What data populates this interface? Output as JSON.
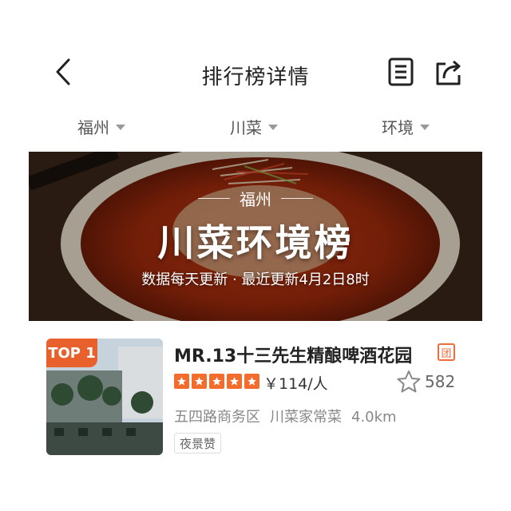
{
  "header": {
    "title": "排行榜详情",
    "back_icon": "chevron-left-icon",
    "list_icon": "document-list-icon",
    "share_icon": "share-icon"
  },
  "filters": {
    "city": "福州",
    "cuisine": "川菜",
    "ambience": "环境"
  },
  "banner": {
    "city": "福州",
    "title": "川菜环境榜",
    "subtitle": "数据每天更新 · 最近更新4月2日8时"
  },
  "ranking": [
    {
      "rank_label": "TOP 1",
      "name": "MR.13十三先生精酿啤酒花园",
      "group_badge": "团",
      "rating_stars": 5,
      "price": "￥114/人",
      "favorite_count": "582",
      "district": "五四路商务区",
      "category": "川菜家常菜",
      "distance": "4.0km",
      "tag": "夜景赞"
    }
  ],
  "colors": {
    "accent": "#f36c2c",
    "badge": "#e8602c",
    "text_primary": "#222222",
    "text_secondary": "#888888"
  }
}
